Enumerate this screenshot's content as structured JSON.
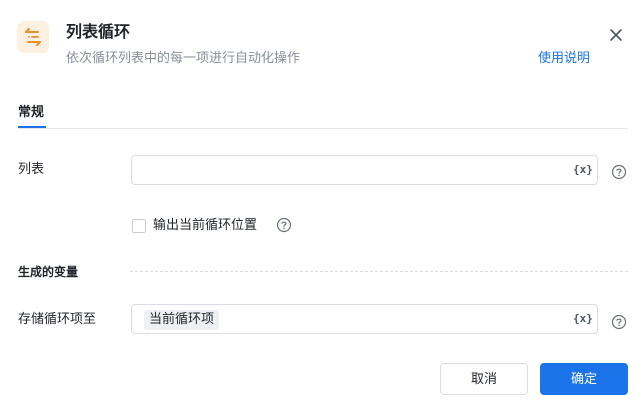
{
  "header": {
    "title": "列表循环",
    "subtitle": "依次循环列表中的每一项进行自动化操作",
    "help_link": "使用说明",
    "icon": "loop-list-icon",
    "icon_color": "#f5a93a"
  },
  "tabs": [
    {
      "label": "常规",
      "active": true
    }
  ],
  "form": {
    "list_label": "列表",
    "list_value": "",
    "list_var_button": "{x}",
    "checkbox_label": "输出当前循环位置",
    "checkbox_checked": false,
    "section_title": "生成的变量",
    "store_label": "存储循环项至",
    "store_tag": "当前循环项",
    "store_var_button": "{x}"
  },
  "footer": {
    "cancel_label": "取消",
    "ok_label": "确定"
  },
  "colors": {
    "accent": "#1a73e8",
    "border": "#d9dce1",
    "muted_text": "#8a8f99"
  }
}
